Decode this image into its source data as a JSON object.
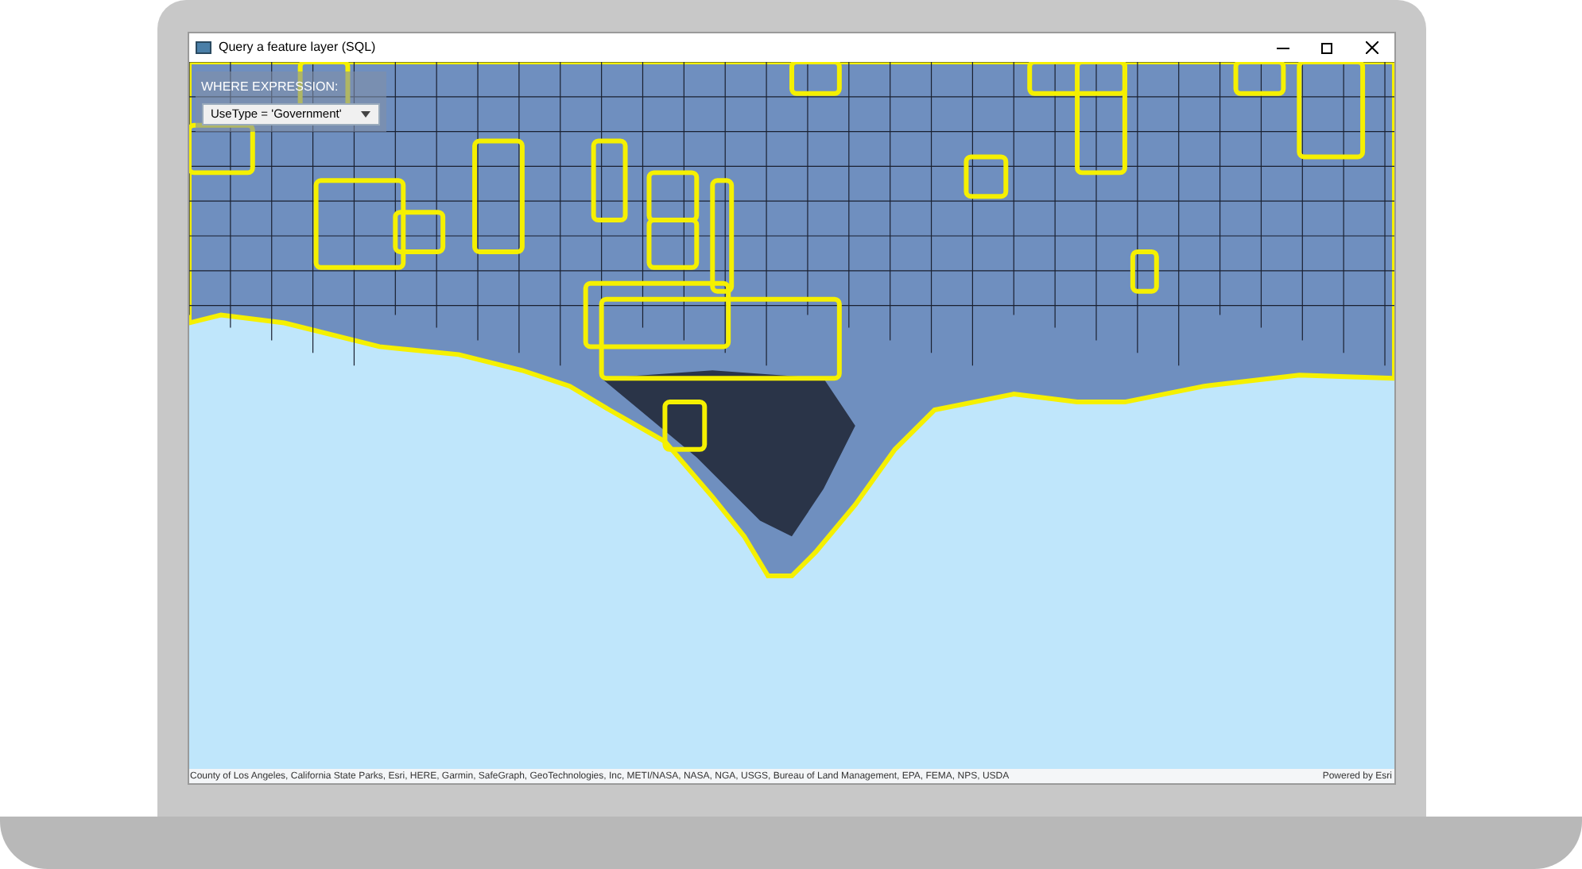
{
  "window": {
    "title": "Query a feature layer (SQL)"
  },
  "query_panel": {
    "label": "WHERE EXPRESSION:",
    "dropdown": {
      "value": "UseType = 'Government'"
    }
  },
  "attribution": {
    "sources": "County of Los Angeles, California State Parks, Esri, HERE, Garmin, SafeGraph, GeoTechnologies, Inc, METI/NASA, NASA, NGA, USGS, Bureau of Land Management, EPA, FEMA, NPS, USDA",
    "powered_by": "Powered by Esri"
  }
}
